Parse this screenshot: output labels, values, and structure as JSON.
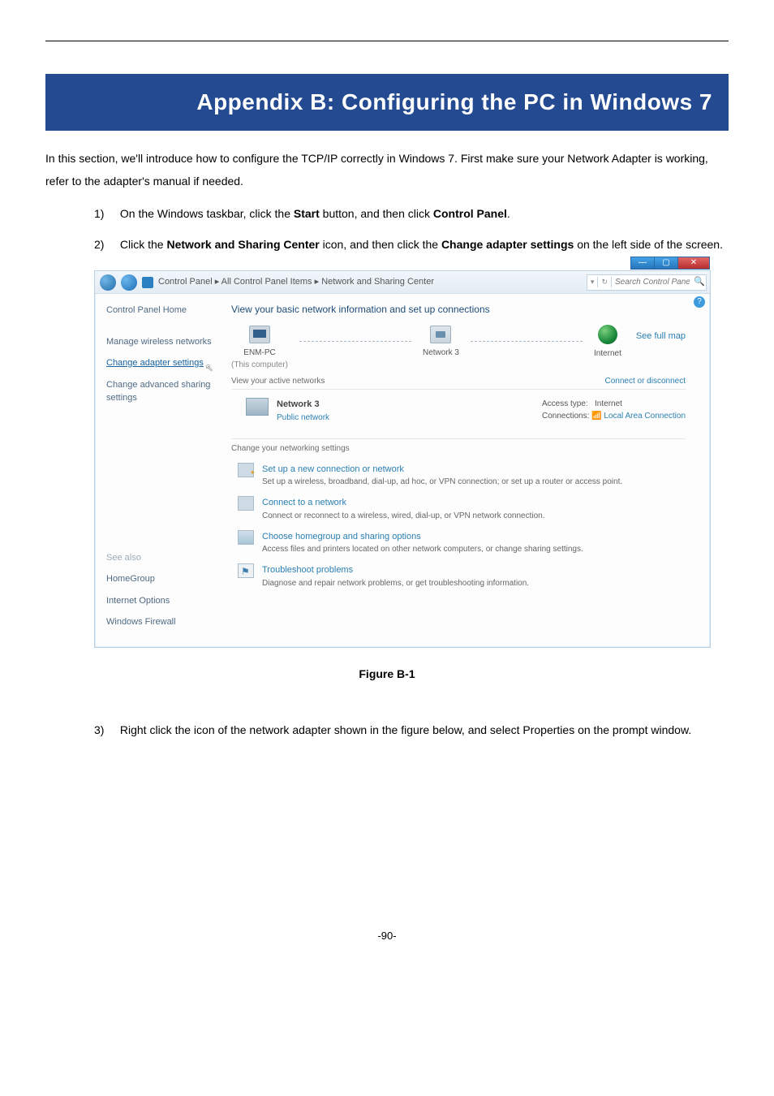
{
  "banner": "Appendix B: Configuring the PC in Windows 7",
  "intro": "In this section, we'll introduce how to configure the TCP/IP correctly in Windows 7. First make sure your Network Adapter is working, refer to the adapter's manual if needed.",
  "step1": {
    "pre": "On the Windows taskbar, click the ",
    "b1": "Start",
    "mid1": " button, and then click ",
    "b2": "Control Panel",
    "post": "."
  },
  "step2": {
    "pre": "Click the ",
    "b1": "Network and Sharing Center",
    "mid1": " icon, and then click the ",
    "b2": "Change adapter settings",
    "post": " on the left side of the screen."
  },
  "figure_caption": "Figure B-1",
  "step3": "Right click the icon of the network adapter shown in the figure below, and select Properties on the prompt window.",
  "page_num": "-90-",
  "win": {
    "breadcrumb": "Control Panel  ▸  All Control Panel Items  ▸  Network and Sharing Center",
    "search_placeholder": "Search Control Panel",
    "help": "?",
    "sidebar": {
      "home": "Control Panel Home",
      "manage": "Manage wireless networks",
      "change": "Change adapter settings",
      "advanced": "Change advanced sharing settings",
      "see_also": "See also",
      "homegroup": "HomeGroup",
      "internet_options": "Internet Options",
      "firewall": "Windows Firewall"
    },
    "main": {
      "h1": "View your basic network information and set up connections",
      "see_map": "See full map",
      "node_pc": "ENM-PC",
      "node_pc_sub": "(This computer)",
      "node_net": "Network  3",
      "node_inet": "Internet",
      "active_h": "View your active networks",
      "connect": "Connect or disconnect",
      "net_name": "Network  3",
      "net_type": "Public network",
      "access_label": "Access type:",
      "access_value": "Internet",
      "conn_label": "Connections:",
      "conn_value": "Local Area Connection",
      "settings_h": "Change your networking settings",
      "s1t": "Set up a new connection or network",
      "s1d": "Set up a wireless, broadband, dial-up, ad hoc, or VPN connection; or set up a router or access point.",
      "s2t": "Connect to a network",
      "s2d": "Connect or reconnect to a wireless, wired, dial-up, or VPN network connection.",
      "s3t": "Choose homegroup and sharing options",
      "s3d": "Access files and printers located on other network computers, or change sharing settings.",
      "s4t": "Troubleshoot problems",
      "s4d": "Diagnose and repair network problems, or get troubleshooting information."
    }
  }
}
